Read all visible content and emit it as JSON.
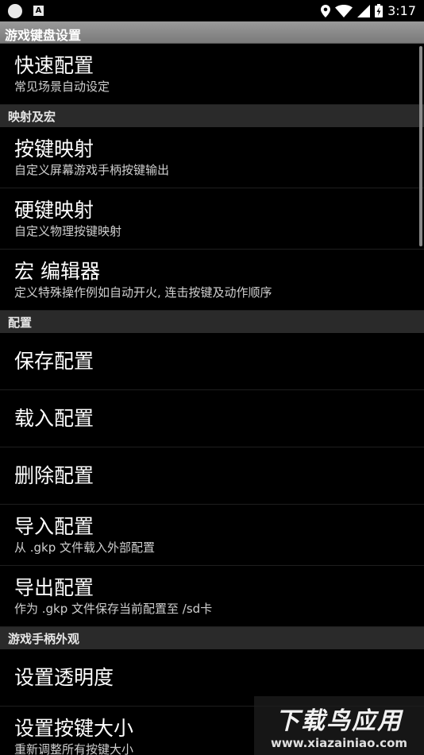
{
  "status": {
    "time": "3:17",
    "icons": [
      "android-app-icon",
      "notification-a-icon",
      "location-icon",
      "wifi-icon",
      "signal-icon",
      "battery-icon"
    ]
  },
  "title": "游戏键盘设置",
  "sections": [
    {
      "header": "",
      "items": [
        {
          "title": "快速配置",
          "subtitle": "常见场景自动设定"
        }
      ]
    },
    {
      "header": "映射及宏",
      "items": [
        {
          "title": "按键映射",
          "subtitle": "自定义屏幕游戏手柄按键输出"
        },
        {
          "title": "硬键映射",
          "subtitle": "自定义物理按键映射"
        },
        {
          "title": "宏 编辑器",
          "subtitle": "定义特殊操作例如自动开火, 连击按键及动作顺序"
        }
      ]
    },
    {
      "header": "配置",
      "items": [
        {
          "title": "保存配置",
          "subtitle": ""
        },
        {
          "title": "载入配置",
          "subtitle": ""
        },
        {
          "title": "删除配置",
          "subtitle": ""
        },
        {
          "title": "导入配置",
          "subtitle": "从 .gkp 文件载入外部配置"
        },
        {
          "title": "导出配置",
          "subtitle": "作为 .gkp 文件保存当前配置至 /sd卡"
        }
      ]
    },
    {
      "header": "游戏手柄外观",
      "items": [
        {
          "title": "设置透明度",
          "subtitle": ""
        },
        {
          "title": "设置按键大小",
          "subtitle": "重新调整所有按键大小"
        }
      ]
    }
  ],
  "watermark": {
    "title": "下载鸟应用",
    "url": "www.xiazainiao.com"
  }
}
